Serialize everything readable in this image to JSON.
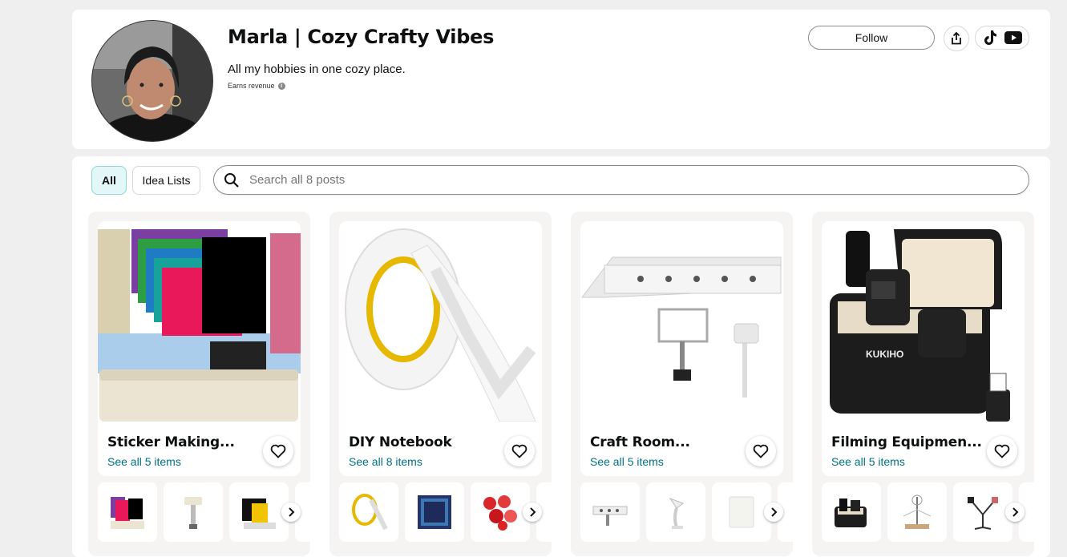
{
  "profile": {
    "name": "Marla | Cozy Crafty Vibes",
    "bio": "All my hobbies in one cozy place.",
    "earns_label": "Earns revenue",
    "follow_label": "Follow",
    "icons": [
      "share-icon",
      "tiktok-icon",
      "youtube-icon",
      "info-icon"
    ]
  },
  "filters": {
    "all_label": "All",
    "idea_lists_label": "Idea Lists",
    "search_placeholder": "Search all 8 posts"
  },
  "cards": [
    {
      "title": "Sticker Making...",
      "link": "See all 5 items"
    },
    {
      "title": "DIY Notebook",
      "link": "See all 8 items"
    },
    {
      "title": "Craft Room...",
      "link": "See all 5 items"
    },
    {
      "title": "Filming Equipmen...",
      "link": "See all 5 items"
    }
  ],
  "colors": {
    "accent_link": "#007185",
    "chip_active_bg": "#e3f6f8",
    "panel_bg": "#ffffff",
    "page_bg": "#efefef"
  }
}
